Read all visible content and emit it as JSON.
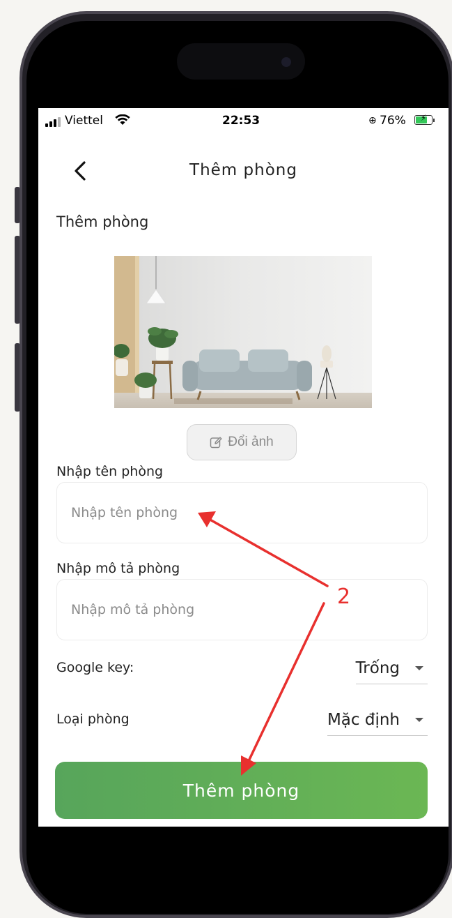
{
  "status_bar": {
    "carrier": "Viettel",
    "time": "22:53",
    "battery_percent": "76%",
    "battery_level": 0.76,
    "icons": [
      "signal-icon",
      "wifi-icon",
      "orientation-lock-icon",
      "battery-charging-icon"
    ]
  },
  "nav": {
    "back_icon": "chevron-left-icon",
    "title": "Thêm phòng"
  },
  "form": {
    "section_title": "Thêm phòng",
    "change_photo_label": "Đổi ảnh",
    "change_photo_icon": "edit-icon",
    "room_name_label": "Nhập tên phòng",
    "room_name_placeholder": "Nhập tên phòng",
    "room_name_value": "",
    "room_desc_label": "Nhập mô tả phòng",
    "room_desc_placeholder": "Nhập mô tả phòng",
    "room_desc_value": "",
    "google_key_label": "Google key:",
    "google_key_selected": "Trống",
    "room_type_label": "Loại phòng",
    "room_type_selected": "Mặc định",
    "submit_label": "Thêm phòng"
  },
  "annotation": {
    "label": "2",
    "color": "#e8302e"
  },
  "colors": {
    "submit_start": "#57a55b",
    "submit_end": "#6bb754",
    "annotation": "#e8302e"
  }
}
